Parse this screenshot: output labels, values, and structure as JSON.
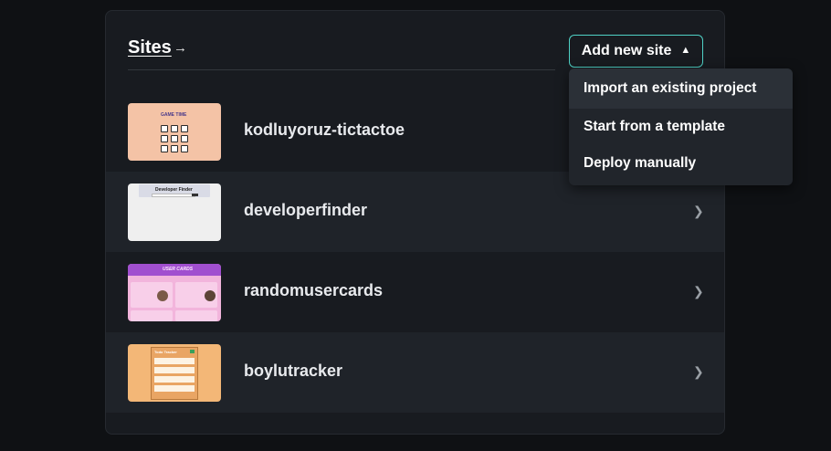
{
  "header": {
    "title": "Sites",
    "arrow": "→",
    "add_button_label": "Add new site"
  },
  "dropdown": {
    "items": [
      {
        "label": "Import an existing project"
      },
      {
        "label": "Start from a template"
      },
      {
        "label": "Deploy manually"
      }
    ]
  },
  "sites": [
    {
      "name": "kodluyoruz-tictactoe",
      "thumb_title": "GAME TIME"
    },
    {
      "name": "developerfinder",
      "thumb_title": "Developer Finder"
    },
    {
      "name": "randomusercards",
      "thumb_title": "USER CARDS"
    },
    {
      "name": "boylutracker",
      "thumb_title": "Todo Tracker"
    }
  ],
  "colors": {
    "accent": "#4fd1c5",
    "panel": "#181b20",
    "row_alt": "#1f2329",
    "menu": "#21252b"
  }
}
